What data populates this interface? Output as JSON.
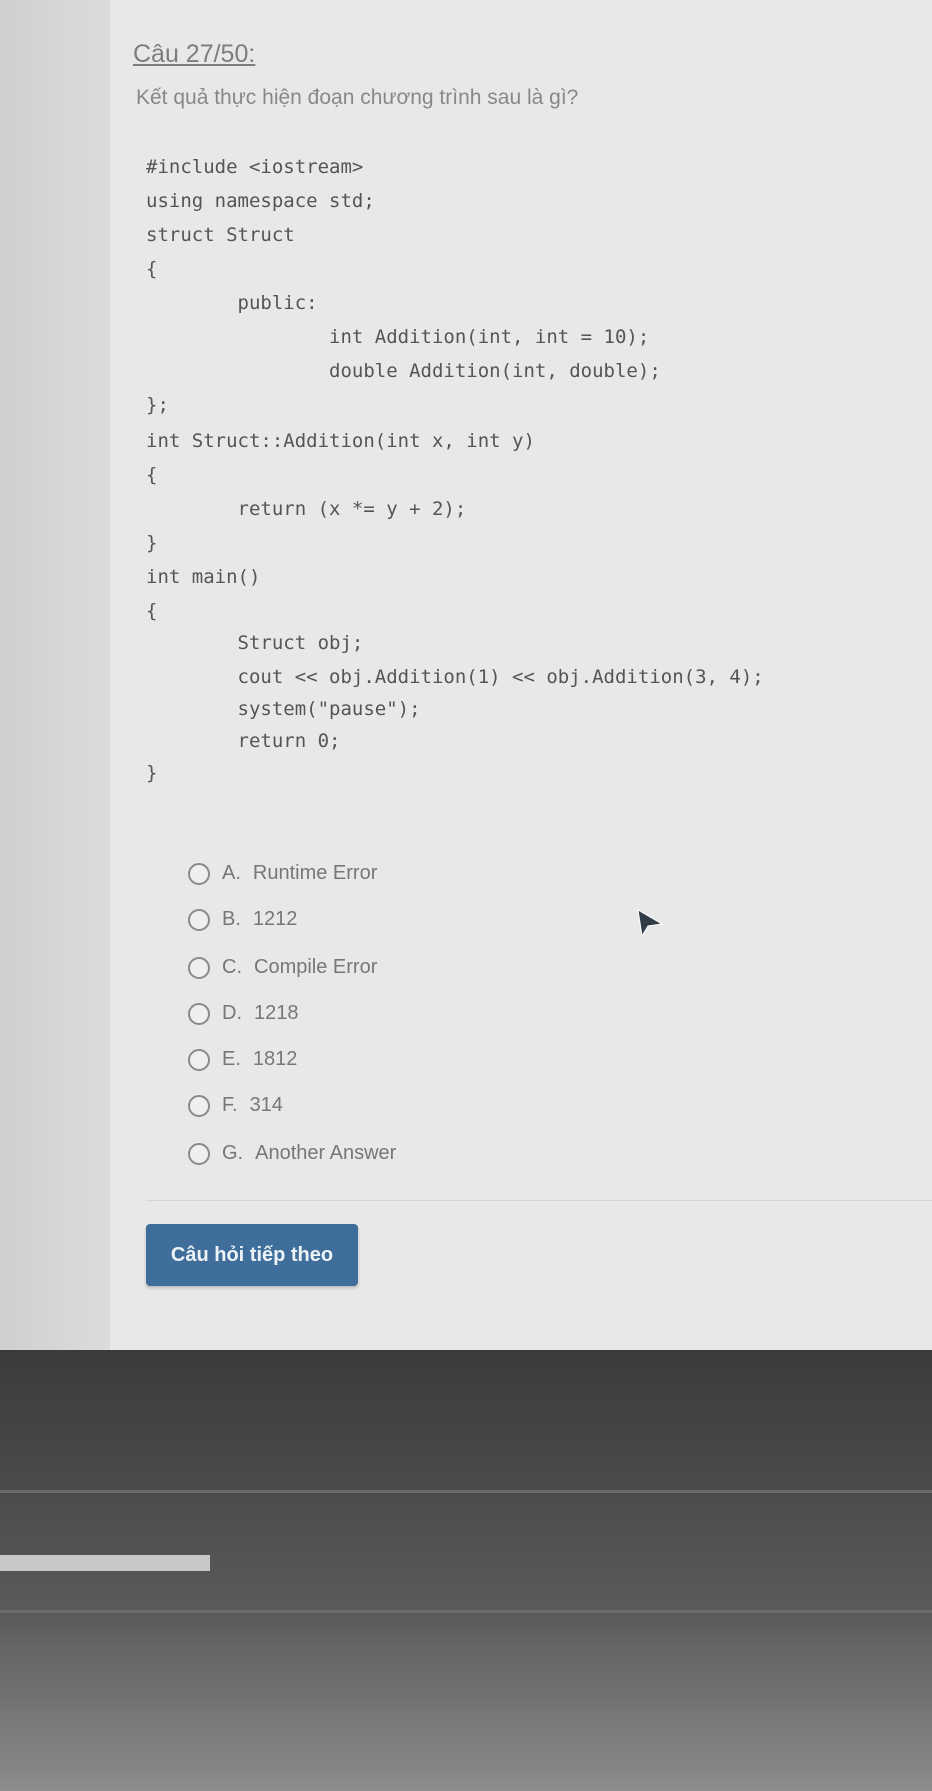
{
  "question": {
    "title": "Câu 27/50:",
    "text": "Kết quả thực hiện đoạn chương trình sau là gì?"
  },
  "code": [
    "#include <iostream>",
    "using namespace std;",
    "struct Struct",
    "{",
    "        public:",
    "                int Addition(int, int = 10);",
    "                double Addition(int, double);",
    "};",
    "int Struct::Addition(int x, int y)",
    "{",
    "        return (x *= y + 2);",
    "}",
    "int main()",
    "{",
    "        Struct obj;",
    "        cout << obj.Addition(1) << obj.Addition(3, 4);",
    "        system(\"pause\");",
    "        return 0;",
    "}"
  ],
  "options": [
    {
      "letter": "A.",
      "text": "Runtime Error"
    },
    {
      "letter": "B.",
      "text": "1212"
    },
    {
      "letter": "C.",
      "text": "Compile Error"
    },
    {
      "letter": "D.",
      "text": "1218"
    },
    {
      "letter": "E.",
      "text": "1812"
    },
    {
      "letter": "F.",
      "text": "314"
    },
    {
      "letter": "G.",
      "text": "Another Answer"
    }
  ],
  "next_button": {
    "label": "Câu hỏi tiếp theo"
  },
  "colors": {
    "button": "#3f6e9a",
    "text": "#777777"
  }
}
